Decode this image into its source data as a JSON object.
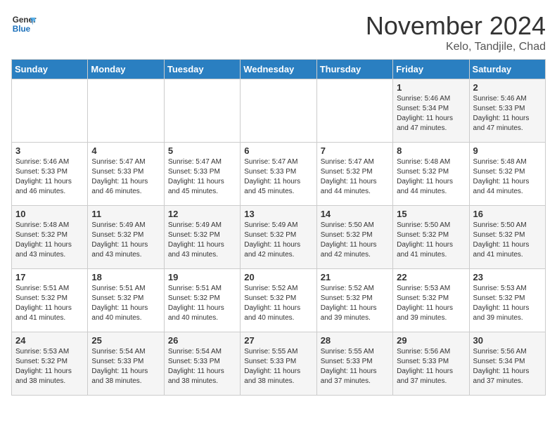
{
  "header": {
    "logo_general": "General",
    "logo_blue": "Blue",
    "month_title": "November 2024",
    "location": "Kelo, Tandjile, Chad"
  },
  "weekdays": [
    "Sunday",
    "Monday",
    "Tuesday",
    "Wednesday",
    "Thursday",
    "Friday",
    "Saturday"
  ],
  "weeks": [
    [
      null,
      null,
      null,
      null,
      null,
      {
        "day": 1,
        "sunrise": "5:46 AM",
        "sunset": "5:34 PM",
        "daylight": "11 hours and 47 minutes."
      },
      {
        "day": 2,
        "sunrise": "5:46 AM",
        "sunset": "5:33 PM",
        "daylight": "11 hours and 47 minutes."
      }
    ],
    [
      {
        "day": 3,
        "sunrise": "5:46 AM",
        "sunset": "5:33 PM",
        "daylight": "11 hours and 46 minutes."
      },
      {
        "day": 4,
        "sunrise": "5:47 AM",
        "sunset": "5:33 PM",
        "daylight": "11 hours and 46 minutes."
      },
      {
        "day": 5,
        "sunrise": "5:47 AM",
        "sunset": "5:33 PM",
        "daylight": "11 hours and 45 minutes."
      },
      {
        "day": 6,
        "sunrise": "5:47 AM",
        "sunset": "5:33 PM",
        "daylight": "11 hours and 45 minutes."
      },
      {
        "day": 7,
        "sunrise": "5:47 AM",
        "sunset": "5:32 PM",
        "daylight": "11 hours and 44 minutes."
      },
      {
        "day": 8,
        "sunrise": "5:48 AM",
        "sunset": "5:32 PM",
        "daylight": "11 hours and 44 minutes."
      },
      {
        "day": 9,
        "sunrise": "5:48 AM",
        "sunset": "5:32 PM",
        "daylight": "11 hours and 44 minutes."
      }
    ],
    [
      {
        "day": 10,
        "sunrise": "5:48 AM",
        "sunset": "5:32 PM",
        "daylight": "11 hours and 43 minutes."
      },
      {
        "day": 11,
        "sunrise": "5:49 AM",
        "sunset": "5:32 PM",
        "daylight": "11 hours and 43 minutes."
      },
      {
        "day": 12,
        "sunrise": "5:49 AM",
        "sunset": "5:32 PM",
        "daylight": "11 hours and 43 minutes."
      },
      {
        "day": 13,
        "sunrise": "5:49 AM",
        "sunset": "5:32 PM",
        "daylight": "11 hours and 42 minutes."
      },
      {
        "day": 14,
        "sunrise": "5:50 AM",
        "sunset": "5:32 PM",
        "daylight": "11 hours and 42 minutes."
      },
      {
        "day": 15,
        "sunrise": "5:50 AM",
        "sunset": "5:32 PM",
        "daylight": "11 hours and 41 minutes."
      },
      {
        "day": 16,
        "sunrise": "5:50 AM",
        "sunset": "5:32 PM",
        "daylight": "11 hours and 41 minutes."
      }
    ],
    [
      {
        "day": 17,
        "sunrise": "5:51 AM",
        "sunset": "5:32 PM",
        "daylight": "11 hours and 41 minutes."
      },
      {
        "day": 18,
        "sunrise": "5:51 AM",
        "sunset": "5:32 PM",
        "daylight": "11 hours and 40 minutes."
      },
      {
        "day": 19,
        "sunrise": "5:51 AM",
        "sunset": "5:32 PM",
        "daylight": "11 hours and 40 minutes."
      },
      {
        "day": 20,
        "sunrise": "5:52 AM",
        "sunset": "5:32 PM",
        "daylight": "11 hours and 40 minutes."
      },
      {
        "day": 21,
        "sunrise": "5:52 AM",
        "sunset": "5:32 PM",
        "daylight": "11 hours and 39 minutes."
      },
      {
        "day": 22,
        "sunrise": "5:53 AM",
        "sunset": "5:32 PM",
        "daylight": "11 hours and 39 minutes."
      },
      {
        "day": 23,
        "sunrise": "5:53 AM",
        "sunset": "5:32 PM",
        "daylight": "11 hours and 39 minutes."
      }
    ],
    [
      {
        "day": 24,
        "sunrise": "5:53 AM",
        "sunset": "5:32 PM",
        "daylight": "11 hours and 38 minutes."
      },
      {
        "day": 25,
        "sunrise": "5:54 AM",
        "sunset": "5:33 PM",
        "daylight": "11 hours and 38 minutes."
      },
      {
        "day": 26,
        "sunrise": "5:54 AM",
        "sunset": "5:33 PM",
        "daylight": "11 hours and 38 minutes."
      },
      {
        "day": 27,
        "sunrise": "5:55 AM",
        "sunset": "5:33 PM",
        "daylight": "11 hours and 38 minutes."
      },
      {
        "day": 28,
        "sunrise": "5:55 AM",
        "sunset": "5:33 PM",
        "daylight": "11 hours and 37 minutes."
      },
      {
        "day": 29,
        "sunrise": "5:56 AM",
        "sunset": "5:33 PM",
        "daylight": "11 hours and 37 minutes."
      },
      {
        "day": 30,
        "sunrise": "5:56 AM",
        "sunset": "5:34 PM",
        "daylight": "11 hours and 37 minutes."
      }
    ]
  ]
}
